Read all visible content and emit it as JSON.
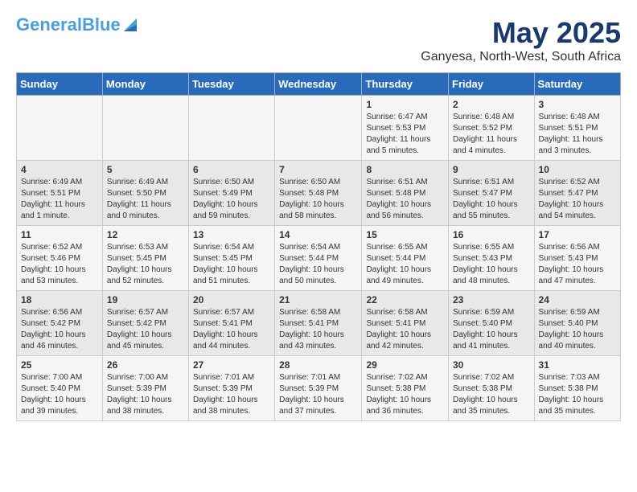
{
  "header": {
    "logo_general": "General",
    "logo_blue": "Blue",
    "month_title": "May 2025",
    "location": "Ganyesa, North-West, South Africa"
  },
  "days_of_week": [
    "Sunday",
    "Monday",
    "Tuesday",
    "Wednesday",
    "Thursday",
    "Friday",
    "Saturday"
  ],
  "weeks": [
    [
      {
        "day": "",
        "info": ""
      },
      {
        "day": "",
        "info": ""
      },
      {
        "day": "",
        "info": ""
      },
      {
        "day": "",
        "info": ""
      },
      {
        "day": "1",
        "info": "Sunrise: 6:47 AM\nSunset: 5:53 PM\nDaylight: 11 hours and 5 minutes."
      },
      {
        "day": "2",
        "info": "Sunrise: 6:48 AM\nSunset: 5:52 PM\nDaylight: 11 hours and 4 minutes."
      },
      {
        "day": "3",
        "info": "Sunrise: 6:48 AM\nSunset: 5:51 PM\nDaylight: 11 hours and 3 minutes."
      }
    ],
    [
      {
        "day": "4",
        "info": "Sunrise: 6:49 AM\nSunset: 5:51 PM\nDaylight: 11 hours and 1 minute."
      },
      {
        "day": "5",
        "info": "Sunrise: 6:49 AM\nSunset: 5:50 PM\nDaylight: 11 hours and 0 minutes."
      },
      {
        "day": "6",
        "info": "Sunrise: 6:50 AM\nSunset: 5:49 PM\nDaylight: 10 hours and 59 minutes."
      },
      {
        "day": "7",
        "info": "Sunrise: 6:50 AM\nSunset: 5:48 PM\nDaylight: 10 hours and 58 minutes."
      },
      {
        "day": "8",
        "info": "Sunrise: 6:51 AM\nSunset: 5:48 PM\nDaylight: 10 hours and 56 minutes."
      },
      {
        "day": "9",
        "info": "Sunrise: 6:51 AM\nSunset: 5:47 PM\nDaylight: 10 hours and 55 minutes."
      },
      {
        "day": "10",
        "info": "Sunrise: 6:52 AM\nSunset: 5:47 PM\nDaylight: 10 hours and 54 minutes."
      }
    ],
    [
      {
        "day": "11",
        "info": "Sunrise: 6:52 AM\nSunset: 5:46 PM\nDaylight: 10 hours and 53 minutes."
      },
      {
        "day": "12",
        "info": "Sunrise: 6:53 AM\nSunset: 5:45 PM\nDaylight: 10 hours and 52 minutes."
      },
      {
        "day": "13",
        "info": "Sunrise: 6:54 AM\nSunset: 5:45 PM\nDaylight: 10 hours and 51 minutes."
      },
      {
        "day": "14",
        "info": "Sunrise: 6:54 AM\nSunset: 5:44 PM\nDaylight: 10 hours and 50 minutes."
      },
      {
        "day": "15",
        "info": "Sunrise: 6:55 AM\nSunset: 5:44 PM\nDaylight: 10 hours and 49 minutes."
      },
      {
        "day": "16",
        "info": "Sunrise: 6:55 AM\nSunset: 5:43 PM\nDaylight: 10 hours and 48 minutes."
      },
      {
        "day": "17",
        "info": "Sunrise: 6:56 AM\nSunset: 5:43 PM\nDaylight: 10 hours and 47 minutes."
      }
    ],
    [
      {
        "day": "18",
        "info": "Sunrise: 6:56 AM\nSunset: 5:42 PM\nDaylight: 10 hours and 46 minutes."
      },
      {
        "day": "19",
        "info": "Sunrise: 6:57 AM\nSunset: 5:42 PM\nDaylight: 10 hours and 45 minutes."
      },
      {
        "day": "20",
        "info": "Sunrise: 6:57 AM\nSunset: 5:41 PM\nDaylight: 10 hours and 44 minutes."
      },
      {
        "day": "21",
        "info": "Sunrise: 6:58 AM\nSunset: 5:41 PM\nDaylight: 10 hours and 43 minutes."
      },
      {
        "day": "22",
        "info": "Sunrise: 6:58 AM\nSunset: 5:41 PM\nDaylight: 10 hours and 42 minutes."
      },
      {
        "day": "23",
        "info": "Sunrise: 6:59 AM\nSunset: 5:40 PM\nDaylight: 10 hours and 41 minutes."
      },
      {
        "day": "24",
        "info": "Sunrise: 6:59 AM\nSunset: 5:40 PM\nDaylight: 10 hours and 40 minutes."
      }
    ],
    [
      {
        "day": "25",
        "info": "Sunrise: 7:00 AM\nSunset: 5:40 PM\nDaylight: 10 hours and 39 minutes."
      },
      {
        "day": "26",
        "info": "Sunrise: 7:00 AM\nSunset: 5:39 PM\nDaylight: 10 hours and 38 minutes."
      },
      {
        "day": "27",
        "info": "Sunrise: 7:01 AM\nSunset: 5:39 PM\nDaylight: 10 hours and 38 minutes."
      },
      {
        "day": "28",
        "info": "Sunrise: 7:01 AM\nSunset: 5:39 PM\nDaylight: 10 hours and 37 minutes."
      },
      {
        "day": "29",
        "info": "Sunrise: 7:02 AM\nSunset: 5:38 PM\nDaylight: 10 hours and 36 minutes."
      },
      {
        "day": "30",
        "info": "Sunrise: 7:02 AM\nSunset: 5:38 PM\nDaylight: 10 hours and 35 minutes."
      },
      {
        "day": "31",
        "info": "Sunrise: 7:03 AM\nSunset: 5:38 PM\nDaylight: 10 hours and 35 minutes."
      }
    ]
  ]
}
